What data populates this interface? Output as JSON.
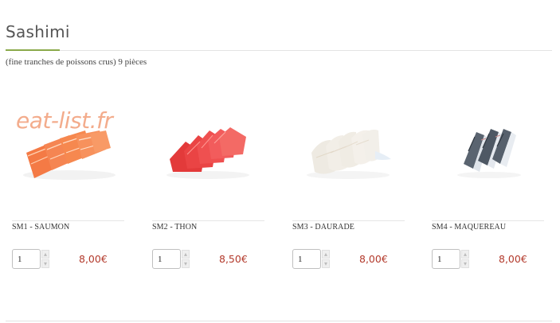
{
  "section": {
    "title": "Sashimi",
    "subtitle": "(fine tranches de poissons crus) 9 pièces"
  },
  "watermark": "eat-list.fr",
  "colors": {
    "accent_green": "#8aa94a",
    "price_red": "#b33a2c",
    "watermark_orange": "#f3a583"
  },
  "products": [
    {
      "name": "SM1 - SAUMON",
      "quantity": "1",
      "price": "8,00€",
      "image": "salmon-sashimi"
    },
    {
      "name": "SM2 - THON",
      "quantity": "1",
      "price": "8,50€",
      "image": "tuna-sashimi"
    },
    {
      "name": "SM3 - DAURADE",
      "quantity": "1",
      "price": "8,00€",
      "image": "sea-bream-sashimi"
    },
    {
      "name": "SM4 - MAQUEREAU",
      "quantity": "1",
      "price": "8,00€",
      "image": "mackerel-sashimi"
    }
  ],
  "stepper": {
    "up_icon": "chevron-up-icon",
    "down_icon": "chevron-down-icon"
  }
}
